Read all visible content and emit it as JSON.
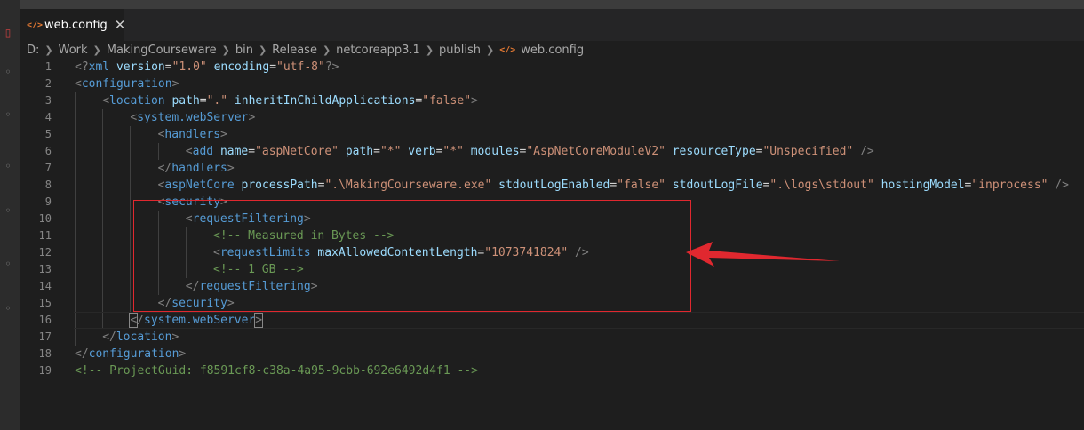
{
  "tab": {
    "icon": "</>",
    "title": "web.config",
    "close": "✕"
  },
  "breadcrumb": {
    "items": [
      "D:",
      "Work",
      "MakingCourseware",
      "bin",
      "Release",
      "netcoreapp3.1",
      "publish"
    ],
    "file_icon": "</>",
    "file": "web.config",
    "separator": "❯"
  },
  "editor": {
    "current_line": 16,
    "lines": [
      {
        "n": "1",
        "indent": 0,
        "tokens": [
          [
            "t",
            "<?"
          ],
          [
            "tn",
            "xml"
          ],
          [
            "eq",
            " "
          ],
          [
            "an",
            "version"
          ],
          [
            "eq",
            "="
          ],
          [
            "av",
            "\"1.0\""
          ],
          [
            "eq",
            " "
          ],
          [
            "an",
            "encoding"
          ],
          [
            "eq",
            "="
          ],
          [
            "av",
            "\"utf-8\""
          ],
          [
            "t",
            "?>"
          ]
        ]
      },
      {
        "n": "2",
        "indent": 0,
        "tokens": [
          [
            "t",
            "<"
          ],
          [
            "tn",
            "configuration"
          ],
          [
            "t",
            ">"
          ]
        ]
      },
      {
        "n": "3",
        "indent": 1,
        "tokens": [
          [
            "t",
            "<"
          ],
          [
            "tn",
            "location"
          ],
          [
            "eq",
            " "
          ],
          [
            "an",
            "path"
          ],
          [
            "eq",
            "="
          ],
          [
            "av",
            "\".\""
          ],
          [
            "eq",
            " "
          ],
          [
            "an",
            "inheritInChildApplications"
          ],
          [
            "eq",
            "="
          ],
          [
            "av",
            "\"false\""
          ],
          [
            "t",
            ">"
          ]
        ]
      },
      {
        "n": "4",
        "indent": 2,
        "tokens": [
          [
            "t",
            "<"
          ],
          [
            "tn",
            "system.webServer"
          ],
          [
            "t",
            ">"
          ]
        ]
      },
      {
        "n": "5",
        "indent": 3,
        "tokens": [
          [
            "t",
            "<"
          ],
          [
            "tn",
            "handlers"
          ],
          [
            "t",
            ">"
          ]
        ]
      },
      {
        "n": "6",
        "indent": 4,
        "tokens": [
          [
            "t",
            "<"
          ],
          [
            "tn",
            "add"
          ],
          [
            "eq",
            " "
          ],
          [
            "an",
            "name"
          ],
          [
            "eq",
            "="
          ],
          [
            "av",
            "\"aspNetCore\""
          ],
          [
            "eq",
            " "
          ],
          [
            "an",
            "path"
          ],
          [
            "eq",
            "="
          ],
          [
            "av",
            "\"*\""
          ],
          [
            "eq",
            " "
          ],
          [
            "an",
            "verb"
          ],
          [
            "eq",
            "="
          ],
          [
            "av",
            "\"*\""
          ],
          [
            "eq",
            " "
          ],
          [
            "an",
            "modules"
          ],
          [
            "eq",
            "="
          ],
          [
            "av",
            "\"AspNetCoreModuleV2\""
          ],
          [
            "eq",
            " "
          ],
          [
            "an",
            "resourceType"
          ],
          [
            "eq",
            "="
          ],
          [
            "av",
            "\"Unspecified\""
          ],
          [
            "eq",
            " "
          ],
          [
            "t",
            "/>"
          ]
        ]
      },
      {
        "n": "7",
        "indent": 3,
        "tokens": [
          [
            "t",
            "</"
          ],
          [
            "tn",
            "handlers"
          ],
          [
            "t",
            ">"
          ]
        ]
      },
      {
        "n": "8",
        "indent": 3,
        "tokens": [
          [
            "t",
            "<"
          ],
          [
            "tn",
            "aspNetCore"
          ],
          [
            "eq",
            " "
          ],
          [
            "an",
            "processPath"
          ],
          [
            "eq",
            "="
          ],
          [
            "av",
            "\".\\MakingCourseware.exe\""
          ],
          [
            "eq",
            " "
          ],
          [
            "an",
            "stdoutLogEnabled"
          ],
          [
            "eq",
            "="
          ],
          [
            "av",
            "\"false\""
          ],
          [
            "eq",
            " "
          ],
          [
            "an",
            "stdoutLogFile"
          ],
          [
            "eq",
            "="
          ],
          [
            "av",
            "\".\\logs\\stdout\""
          ],
          [
            "eq",
            " "
          ],
          [
            "an",
            "hostingModel"
          ],
          [
            "eq",
            "="
          ],
          [
            "av",
            "\"inprocess\""
          ],
          [
            "eq",
            " "
          ],
          [
            "t",
            "/>"
          ]
        ]
      },
      {
        "n": "9",
        "indent": 3,
        "tokens": [
          [
            "t",
            "<"
          ],
          [
            "tn",
            "security"
          ],
          [
            "t",
            ">"
          ]
        ]
      },
      {
        "n": "10",
        "indent": 4,
        "tokens": [
          [
            "t",
            "<"
          ],
          [
            "tn",
            "requestFiltering"
          ],
          [
            "t",
            ">"
          ]
        ]
      },
      {
        "n": "11",
        "indent": 5,
        "tokens": [
          [
            "cm",
            "<!-- Measured in Bytes -->"
          ]
        ]
      },
      {
        "n": "12",
        "indent": 5,
        "tokens": [
          [
            "t",
            "<"
          ],
          [
            "tn",
            "requestLimits"
          ],
          [
            "eq",
            " "
          ],
          [
            "an",
            "maxAllowedContentLength"
          ],
          [
            "eq",
            "="
          ],
          [
            "av",
            "\"1073741824\""
          ],
          [
            "eq",
            " "
          ],
          [
            "t",
            "/>"
          ]
        ]
      },
      {
        "n": "13",
        "indent": 5,
        "tokens": [
          [
            "cm",
            "<!-- 1 GB -->"
          ]
        ]
      },
      {
        "n": "14",
        "indent": 4,
        "tokens": [
          [
            "t",
            "</"
          ],
          [
            "tn",
            "requestFiltering"
          ],
          [
            "t",
            ">"
          ]
        ]
      },
      {
        "n": "15",
        "indent": 3,
        "tokens": [
          [
            "t",
            "</"
          ],
          [
            "tn",
            "security"
          ],
          [
            "t",
            ">"
          ]
        ]
      },
      {
        "n": "16",
        "indent": 2,
        "tokens": [
          [
            "t",
            "<",
            1
          ],
          [
            "t",
            "/"
          ],
          [
            "tn",
            "system.webServer"
          ],
          [
            "t",
            ">",
            1
          ]
        ]
      },
      {
        "n": "17",
        "indent": 1,
        "tokens": [
          [
            "t",
            "</"
          ],
          [
            "tn",
            "location"
          ],
          [
            "t",
            ">"
          ]
        ]
      },
      {
        "n": "18",
        "indent": 0,
        "tokens": [
          [
            "t",
            "</"
          ],
          [
            "tn",
            "configuration"
          ],
          [
            "t",
            ">"
          ]
        ]
      },
      {
        "n": "19",
        "indent": 0,
        "tokens": [
          [
            "cm",
            "<!-- ProjectGuid: f8591cf8-c38a-4a95-9cbb-692e6492d4f1 -->"
          ]
        ]
      }
    ]
  },
  "colors": {
    "background": "#1e1e1e",
    "tag": "#569cd6",
    "attribute": "#9cdcfe",
    "string": "#ce9178",
    "comment": "#6a9955",
    "annotation": "#e0282f"
  }
}
